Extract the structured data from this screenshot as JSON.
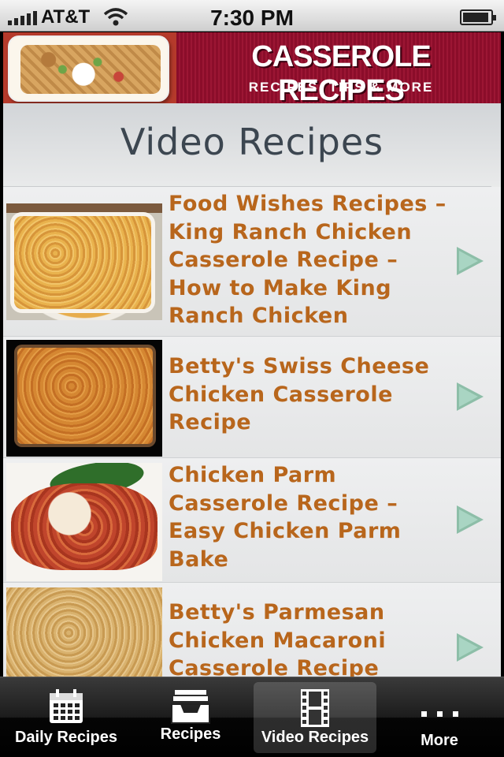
{
  "status_bar": {
    "carrier": "AT&T",
    "time": "7:30 PM"
  },
  "banner": {
    "title": "CASSEROLE RECIPES",
    "subtitle": "RECIPES, TIPS & MORE"
  },
  "page": {
    "title": "Video Recipes"
  },
  "videos": [
    {
      "title": "Food Wishes Recipes – King Ranch Chicken Casserole Recipe – How to Make King Ranch Chicken"
    },
    {
      "title": "Betty's Swiss Cheese Chicken Casserole Recipe"
    },
    {
      "title": "Chicken Parm Casserole Recipe – Easy Chicken Parm Bake"
    },
    {
      "title": "Betty's Parmesan Chicken Macaroni Casserole Recipe"
    }
  ],
  "tabs": [
    {
      "label": "Daily Recipes",
      "icon": "calendar-icon",
      "active": false
    },
    {
      "label": "Recipes",
      "icon": "inbox-tray-icon",
      "active": false
    },
    {
      "label": "Video Recipes",
      "icon": "film-strip-icon",
      "active": true
    },
    {
      "label": "More",
      "icon": "more-dots-icon",
      "active": false
    }
  ],
  "colors": {
    "link_text": "#b8661c",
    "banner_bg": "#8b0d2a",
    "disclosure_arrow": "#8dbea8"
  }
}
